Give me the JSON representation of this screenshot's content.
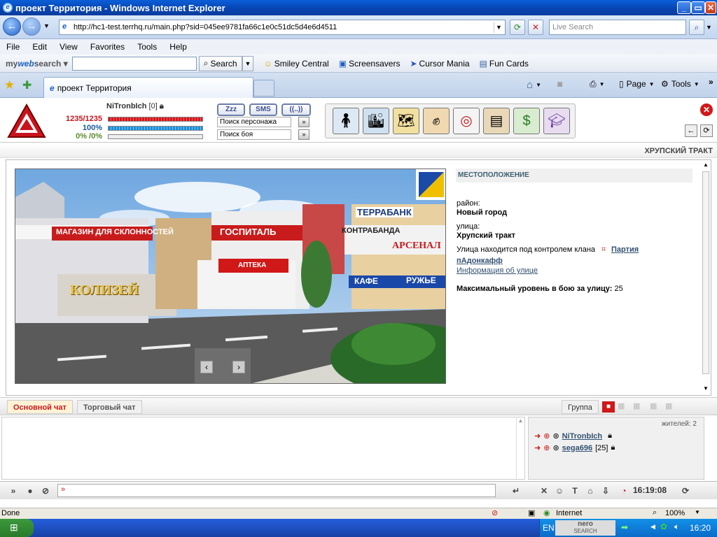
{
  "window": {
    "title": "проект Территория - Windows Internet Explorer"
  },
  "addressbar": {
    "url": "http://hc1-test.terrhq.ru/main.php?sid=045ee9781fa66c1e0c51dc5d4e6d4511",
    "search_placeholder": "Live Search"
  },
  "menu": [
    "File",
    "Edit",
    "View",
    "Favorites",
    "Tools",
    "Help"
  ],
  "toolbar": {
    "mywebsearch_prefix": "my",
    "mywebsearch_brand": "web",
    "mywebsearch_suffix": "search",
    "search_button": "Search",
    "smiley": "Smiley Central",
    "screensavers": "Screensavers",
    "cursor": "Cursor Mania",
    "funcards": "Fun Cards"
  },
  "tabs": {
    "active_label": "проект Территория",
    "page_label": "Page",
    "tools_label": "Tools"
  },
  "player": {
    "name": "NiTronbIch",
    "level": "[0]",
    "hp": "1235/1235",
    "energy": "100%",
    "exp": "0% /0%"
  },
  "buttons": {
    "zzz": "Zzz",
    "sms": "SMS",
    "group": "((..))"
  },
  "search": {
    "person_placeholder": "Поиск персонажа",
    "battle_placeholder": "Поиск боя"
  },
  "location": {
    "street_title": "ХРУПСКИЙ ТРАКТ",
    "header": "МЕСТОПОЛОЖЕНИЕ",
    "district_label": "район:",
    "district_value": "Новый город",
    "street_label": "улица:",
    "street_value": "Хрупский тракт",
    "control_text": "Улица находится под контролем клана",
    "clan_link_1": "Партия",
    "clan_link_2": "пАдонкафф",
    "info_link": "Информация об улице",
    "max_level_label": "Максимальный уровень в бою за улицу:",
    "max_level_value": "25"
  },
  "scene": {
    "sign_shop": "МАГАЗИН ДЛЯ СКЛОННОСТЕЙ",
    "sign_koliseum": "КОЛИЗЕЙ",
    "sign_hospital": "ГОСПИТАЛЬ",
    "sign_pharmacy": "АПТЕКА",
    "sign_bank": "ТЕРРАБАНК",
    "sign_contraband": "КОНТРАБАНДА",
    "sign_arsenal": "АРСЕНАЛ",
    "sign_cafe": "КАФЕ",
    "sign_weapons": "РУЖЬЕ"
  },
  "chat": {
    "tab_main": "Основной чат",
    "tab_trade": "Торговый чат",
    "tab_group": "Группа",
    "residents": "жителей: 2",
    "users": [
      {
        "name": "NiTronbIch",
        "level": ""
      },
      {
        "name": "sega696",
        "level": "[25]"
      }
    ],
    "time": "16:19:08"
  },
  "statusbar": {
    "left": "Done",
    "zone": "Internet",
    "zoom": "100%"
  },
  "taskbar": {
    "lang": "EN",
    "nero": "nero",
    "nero_sub": "SEARCH",
    "clock": "16:20"
  },
  "colors": {
    "accent_red": "#c8141c",
    "link_blue": "#325070",
    "hp_red": "#d4161c",
    "mana_blue": "#1a8ed8"
  }
}
